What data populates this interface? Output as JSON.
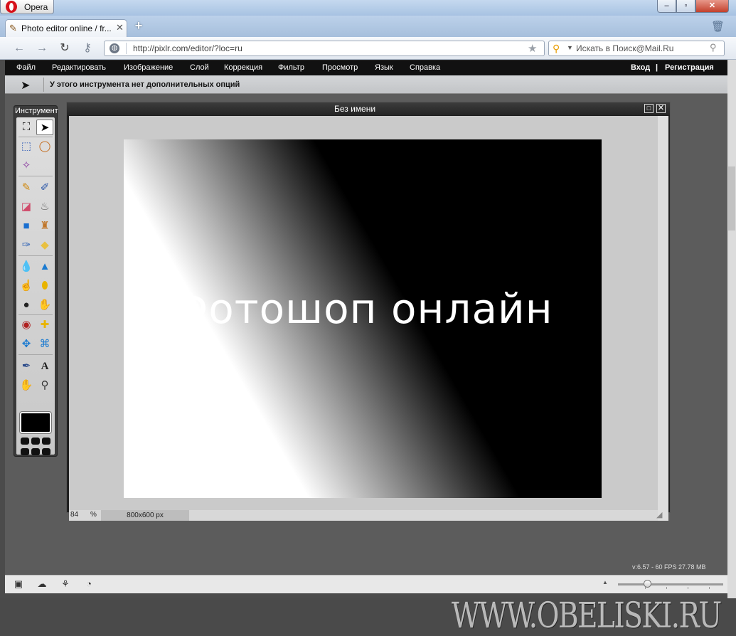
{
  "browser": {
    "app_name": "Opera",
    "tab_title": "Photo editor online / fr...",
    "url": "http://pixlr.com/editor/?loc=ru",
    "search_placeholder": "Искать в Поиск@Mail.Ru"
  },
  "menu": {
    "items": [
      "Файл",
      "Редактировать",
      "Изображение",
      "Слой",
      "Коррекция",
      "Фильтр",
      "Просмотр",
      "Язык",
      "Справка"
    ],
    "login": "Вход",
    "separator": "|",
    "register": "Регистрация"
  },
  "options_bar": {
    "text": "У этого инструмента нет дополнительных опций"
  },
  "tools_panel": {
    "title": "Инструменты",
    "tools": [
      "crop-icon",
      "move-icon",
      "marquee-icon",
      "lasso-icon",
      "magic-wand-icon",
      "pencil-icon",
      "brush-icon",
      "eraser-icon",
      "paint-bucket-icon",
      "gradient-icon",
      "clone-stamp-icon",
      "color-replace-icon",
      "shape-icon",
      "blur-icon",
      "sharpen-icon",
      "smudge-icon",
      "sponge-icon",
      "burn-icon",
      "dodge-icon",
      "red-eye-icon",
      "spot-heal-icon",
      "bloat-icon",
      "pinch-icon",
      "eyedropper-icon",
      "text-icon",
      "hand-icon",
      "zoom-icon"
    ],
    "foreground_color": "#000000"
  },
  "document": {
    "title": "Без имени",
    "canvas_text": "Фотошоп онлайн",
    "zoom_value": "84",
    "zoom_unit": "%",
    "size": "800x600 px"
  },
  "status": {
    "stats": "v:6.57 - 60 FPS 27.78 MB"
  },
  "watermark": "WWW.OBELISKI.RU"
}
